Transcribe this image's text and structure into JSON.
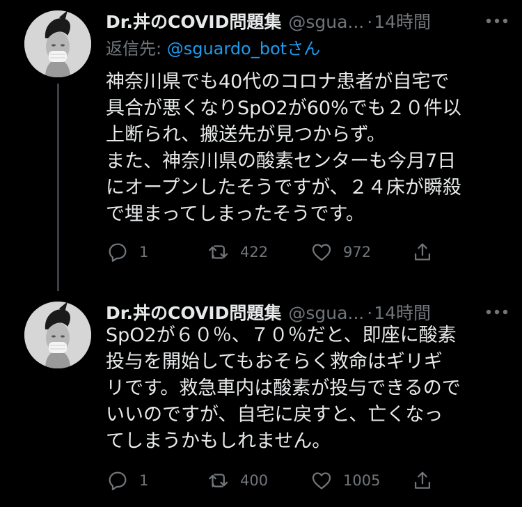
{
  "tweets": [
    {
      "name": "Dr.丼のCOVID問題集",
      "handle": "@sgua...",
      "separator": "·",
      "time": "14時間",
      "reply_prefix": "返信先: ",
      "reply_to": "@sguardo_botさん",
      "lines": [
        "神奈川県でも40代のコロナ患者が自宅で",
        "具合が悪くなりSpO2が60%でも２０件以",
        "上断られ、搬送先が見つからず。",
        "また、神奈川県の酸素センターも今月7日",
        "にオープンしたそうですが、２４床が瞬殺",
        "で埋まってしまったそうです。"
      ],
      "replies": "1",
      "retweets": "422",
      "likes": "972"
    },
    {
      "name": "Dr.丼のCOVID問題集",
      "handle": "@sgua...",
      "separator": "·",
      "time": "14時間",
      "lines": [
        "SpO2が６０％、７０％だと、即座に酸素",
        "投与を開始してもおそらく救命はギリギ",
        "リです。救急車内は酸素が投与できるので",
        "いいのですが、自宅に戻すと、亡くなっ",
        "てしまうかもしれません。"
      ],
      "replies": "1",
      "retweets": "400",
      "likes": "1005"
    }
  ],
  "icons": {
    "more": "more-icon",
    "reply": "reply-icon",
    "retweet": "retweet-icon",
    "like": "heart-icon",
    "share": "share-icon"
  },
  "colors": {
    "background": "#000000",
    "text": "#e7e9ea",
    "muted": "#71767b",
    "link": "#1d9bf0",
    "thread_line": "#3d4147"
  }
}
